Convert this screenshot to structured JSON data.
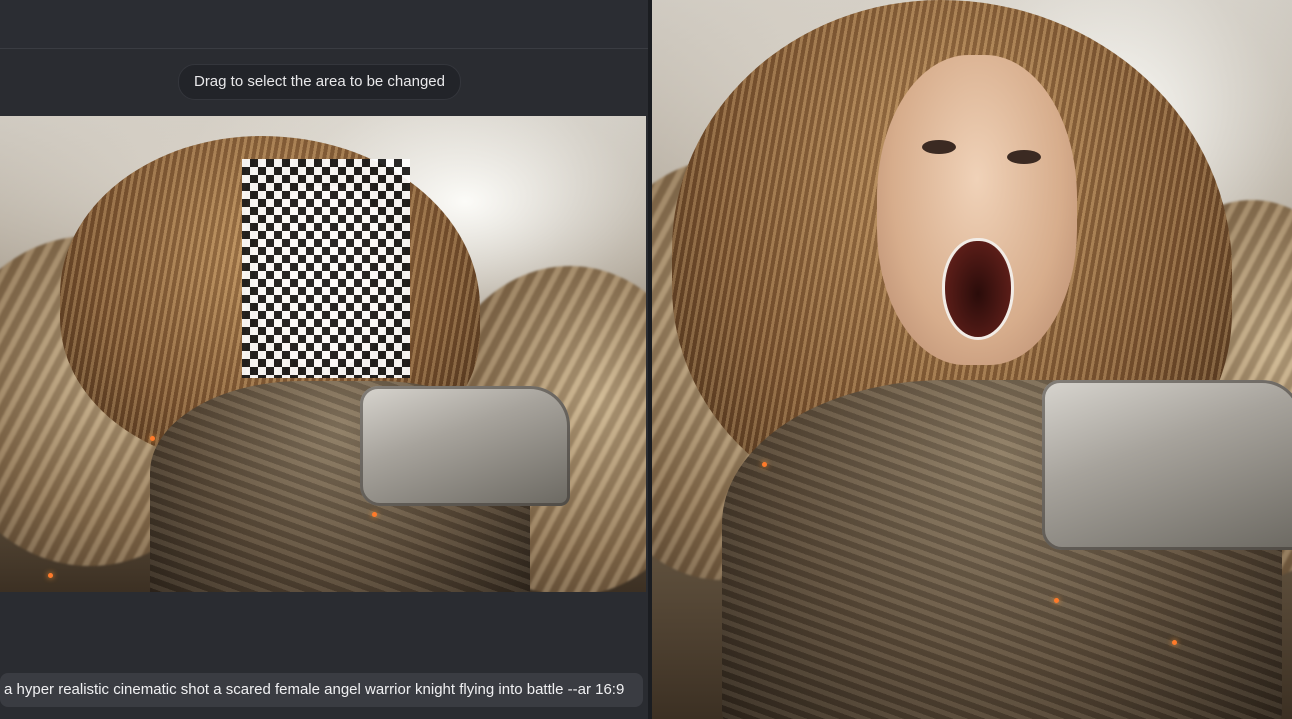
{
  "editor": {
    "hint_text": "Drag to select the area to be changed",
    "prompt_text": "a hyper realistic cinematic shot a scared female angel warrior knight flying into battle --ar 16:9"
  },
  "colors": {
    "panel_background": "#2a2c31",
    "prompt_field": "#3a3c42",
    "mask_dark": "#1a1a1a",
    "mask_light": "#ffffff"
  }
}
